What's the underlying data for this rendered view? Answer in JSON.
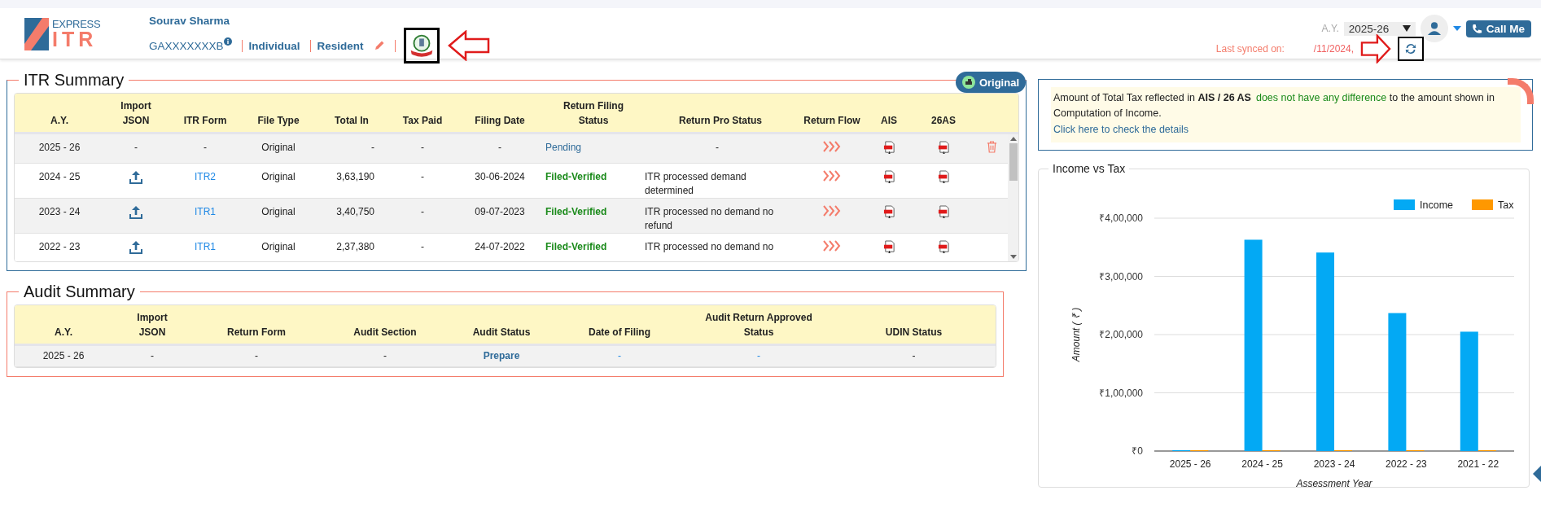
{
  "header": {
    "logo": {
      "top": "EXPRESS",
      "bottom": "ITR"
    },
    "user": {
      "name": "Sourav Sharma",
      "pan": "GAXXXXXXXB",
      "type": "Individual",
      "residency": "Resident"
    },
    "ay": {
      "label": "A.Y.",
      "value": "2025-26"
    },
    "sync": {
      "label": "Last synced on:",
      "date": "/11/2024,"
    },
    "call_button": "Call Me"
  },
  "itr_summary": {
    "title": "ITR Summary",
    "badge": "Original",
    "columns": [
      [
        "A.Y."
      ],
      [
        "Import",
        "JSON"
      ],
      [
        "ITR Form"
      ],
      [
        "File Type"
      ],
      [
        "Total In"
      ],
      [
        "Tax Paid"
      ],
      [
        "Filing Date"
      ],
      [
        "Return Filing",
        "Status"
      ],
      [
        "Return Pro Status"
      ],
      [
        "Return Flow"
      ],
      [
        "AIS"
      ],
      [
        "26AS"
      ]
    ],
    "rows": [
      {
        "ay": "2025 - 26",
        "import_json": "-",
        "upload": false,
        "form": "-",
        "form_link": false,
        "file_type": "Original",
        "total_in": "-",
        "tax_paid": "-",
        "filing_date": "-",
        "filing_status": "Pending",
        "verified": false,
        "pro_status": "-",
        "deletable": true
      },
      {
        "ay": "2024 - 25",
        "upload": true,
        "form": "ITR2",
        "form_link": true,
        "file_type": "Original",
        "total_in": "3,63,190",
        "tax_paid": "-",
        "filing_date": "30-06-2024",
        "filing_status": "Filed-Verified",
        "verified": true,
        "pro_status": "ITR processed demand determined",
        "deletable": false
      },
      {
        "ay": "2023 - 24",
        "upload": true,
        "form": "ITR1",
        "form_link": true,
        "file_type": "Original",
        "total_in": "3,40,750",
        "tax_paid": "-",
        "filing_date": "09-07-2023",
        "filing_status": "Filed-Verified",
        "verified": true,
        "pro_status": "ITR processed no demand no refund",
        "deletable": false
      },
      {
        "ay": "2022 - 23",
        "upload": true,
        "form": "ITR1",
        "form_link": true,
        "file_type": "Original",
        "total_in": "2,37,380",
        "tax_paid": "-",
        "filing_date": "24-07-2022",
        "filing_status": "Filed-Verified",
        "verified": true,
        "pro_status": "ITR processed no demand no",
        "deletable": false
      }
    ]
  },
  "audit_summary": {
    "title": "Audit Summary",
    "columns": [
      [
        "A.Y."
      ],
      [
        "Import",
        "JSON"
      ],
      [
        "Return Form"
      ],
      [
        "Audit Section"
      ],
      [
        "Audit Status"
      ],
      [
        "Date of Filing"
      ],
      [
        "Audit Return Approved",
        "Status"
      ],
      [
        "UDIN Status"
      ]
    ],
    "rows": [
      {
        "ay": "2025 - 26",
        "import_json": "-",
        "return_form": "-",
        "audit_section": "-",
        "audit_status": "Prepare",
        "date_of_filing": "-",
        "approved_status": "-",
        "udin_status": "-"
      }
    ]
  },
  "notice": {
    "segments": [
      {
        "kind": "plain",
        "text": "Amount of Total Tax reflected in "
      },
      {
        "kind": "bold",
        "text": "AIS / 26 AS"
      },
      {
        "kind": "good",
        "text": "does not have any difference"
      },
      {
        "kind": "plain",
        "text": " to the amount shown in Computation of Income."
      }
    ],
    "link": "Click here to check the details"
  },
  "income_chart": {
    "title": "Income vs Tax",
    "chart_data": {
      "type": "bar",
      "xlabel": "Assessment Year",
      "ylabel": "Amount ( ₹ )",
      "categories": [
        "2025 - 26",
        "2024 - 25",
        "2023 - 24",
        "2022 - 23",
        "2021 - 22"
      ],
      "series": [
        {
          "name": "Income",
          "color": "#03a9f4",
          "values": [
            0,
            363000,
            341000,
            237000,
            205000
          ]
        },
        {
          "name": "Tax",
          "color": "#ff9800",
          "values": [
            0,
            0,
            0,
            0,
            0
          ]
        }
      ],
      "ylim": [
        0,
        400000
      ],
      "grid": true,
      "legend": true,
      "yticks": [
        {
          "value": 0,
          "label": "₹0"
        },
        {
          "value": 100000,
          "label": "₹1,00,000"
        },
        {
          "value": 200000,
          "label": "₹2,00,000"
        },
        {
          "value": 300000,
          "label": "₹3,00,000"
        },
        {
          "value": 400000,
          "label": "₹4,00,000"
        }
      ]
    }
  }
}
